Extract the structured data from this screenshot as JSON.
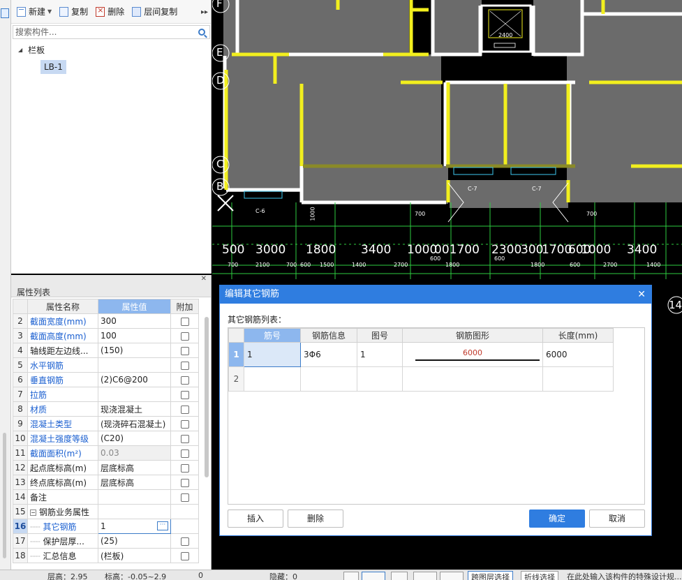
{
  "toolbar": {
    "new_label": "新建",
    "copy_label": "复制",
    "delete_label": "删除",
    "floor_copy_label": "层间复制"
  },
  "search": {
    "placeholder": "搜索构件..."
  },
  "tree": {
    "root_label": "栏板",
    "child_label": "LB-1"
  },
  "properties": {
    "panel_title": "属性列表",
    "headers": {
      "name": "属性名称",
      "value": "属性值",
      "extra": "附加"
    },
    "rows": [
      {
        "num": "2",
        "name": "截面宽度(mm)",
        "value": "300"
      },
      {
        "num": "3",
        "name": "截面高度(mm)",
        "value": "100"
      },
      {
        "num": "4",
        "name": "轴线距左边线...",
        "value": "(150)"
      },
      {
        "num": "5",
        "name": "水平钢筋",
        "value": ""
      },
      {
        "num": "6",
        "name": "垂直钢筋",
        "value": "(2)C6@200"
      },
      {
        "num": "7",
        "name": "拉筋",
        "value": ""
      },
      {
        "num": "8",
        "name": "材质",
        "value": "现浇混凝土"
      },
      {
        "num": "9",
        "name": "混凝土类型",
        "value": "(现浇碎石混凝土)"
      },
      {
        "num": "10",
        "name": "混凝土强度等级",
        "value": "(C20)"
      },
      {
        "num": "11",
        "name": "截面面积(m²)",
        "value": "0.03"
      },
      {
        "num": "12",
        "name": "起点底标高(m)",
        "value": "层底标高"
      },
      {
        "num": "13",
        "name": "终点底标高(m)",
        "value": "层底标高"
      },
      {
        "num": "14",
        "name": "备注",
        "value": ""
      },
      {
        "num": "15",
        "name": "钢筋业务属性",
        "value": ""
      },
      {
        "num": "16",
        "name": "其它钢筋",
        "value": "1"
      },
      {
        "num": "17",
        "name": "保护层厚...",
        "value": "(25)"
      },
      {
        "num": "18",
        "name": "汇总信息",
        "value": "(栏板)"
      }
    ]
  },
  "cad": {
    "axis_labels": [
      "F",
      "E",
      "D",
      "C",
      "B",
      "14"
    ],
    "dims_large": [
      "500",
      "3000",
      "1800",
      "3400",
      "1000",
      "001700",
      "2300",
      "300",
      "1700",
      "600",
      "1000",
      "3400"
    ],
    "dims_small": [
      "700",
      "2100",
      "700",
      "600",
      "1500",
      "1400",
      "2700",
      "600",
      "1800",
      "600",
      "1800",
      "600",
      "2700",
      "1400",
      "1000",
      "700",
      "700",
      "C-6",
      "C-7",
      "C-7",
      "2400"
    ]
  },
  "status": {
    "floor_height": "层高：2.95",
    "elevation": "标高：-0.05~2.9",
    "zero": "0",
    "hidden": "隐藏：0",
    "select_mode": "跨图层选择",
    "polyline_select": "折线选择",
    "hint": "在此处输入该构件的特殊设计规..."
  },
  "dialog": {
    "title": "编辑其它钢筋",
    "sublabel": "其它钢筋列表：",
    "columns": [
      "筋号",
      "钢筋信息",
      "图号",
      "钢筋图形",
      "长度(mm)"
    ],
    "rows": [
      {
        "rownum": "1",
        "bar_no": "1",
        "info": "3Φ6",
        "fig_no": "1",
        "shape_value": "6000",
        "length": "6000"
      },
      {
        "rownum": "2",
        "bar_no": "",
        "info": "",
        "fig_no": "",
        "shape_value": "",
        "length": ""
      }
    ],
    "buttons": {
      "insert": "插入",
      "delete": "删除",
      "ok": "确定",
      "cancel": "取消"
    }
  }
}
